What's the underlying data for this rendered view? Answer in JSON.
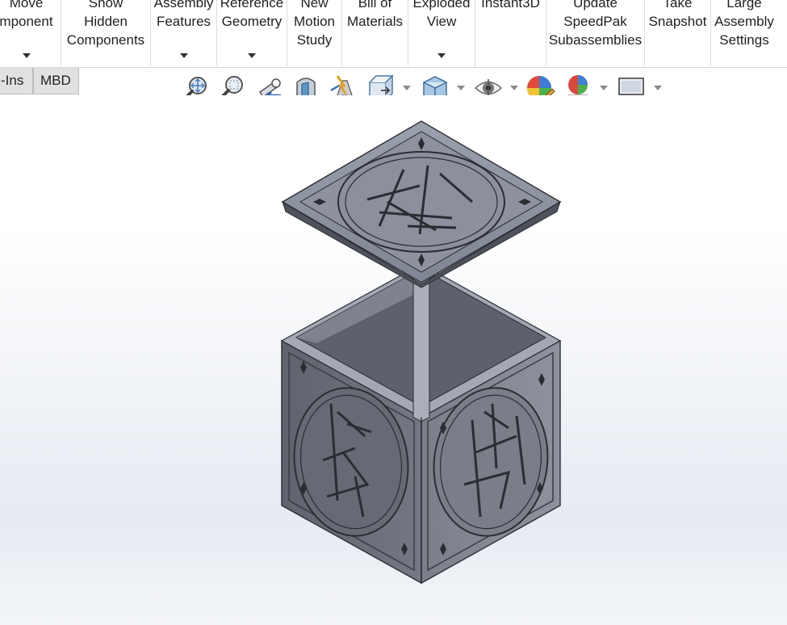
{
  "ribbon": {
    "buttons": [
      {
        "label_lines": [
          "Move",
          "mponent"
        ],
        "has_dropdown": true
      },
      {
        "label_lines": [
          "Show",
          "Hidden",
          "Components"
        ],
        "has_dropdown": false
      },
      {
        "label_lines": [
          "Assembly",
          "Features"
        ],
        "has_dropdown": true
      },
      {
        "label_lines": [
          "Reference",
          "Geometry"
        ],
        "has_dropdown": true
      },
      {
        "label_lines": [
          "New",
          "Motion",
          "Study"
        ],
        "has_dropdown": false
      },
      {
        "label_lines": [
          "Bill of",
          "Materials"
        ],
        "has_dropdown": false
      },
      {
        "label_lines": [
          "Exploded",
          "View"
        ],
        "has_dropdown": true
      },
      {
        "label_lines": [
          "Instant3D"
        ],
        "has_dropdown": false
      },
      {
        "label_lines": [
          "Update",
          "SpeedPak",
          "Subassemblies"
        ],
        "has_dropdown": false
      },
      {
        "label_lines": [
          "Take",
          "Snapshot"
        ],
        "has_dropdown": false
      },
      {
        "label_lines": [
          "Large",
          "Assembly",
          "Settings"
        ],
        "has_dropdown": false
      }
    ]
  },
  "tabs": [
    {
      "label": "-Ins"
    },
    {
      "label": "MBD"
    }
  ],
  "view_toolbar": {
    "icons": [
      "zoom-to-fit-icon",
      "zoom-to-area-icon",
      "previous-view-icon",
      "section-view-icon",
      "dynamic-annotation-views-icon",
      "view-orientation-icon",
      "display-style-icon",
      "hide-show-items-icon",
      "edit-appearance-icon",
      "apply-scene-icon",
      "view-settings-icon"
    ]
  },
  "model": {
    "description_colors": {
      "top_face": "#8e939f",
      "left_face": "#6a6e79",
      "right_face": "#7d818c",
      "edge": "#2b2d33",
      "inner": "#5d616b"
    }
  }
}
